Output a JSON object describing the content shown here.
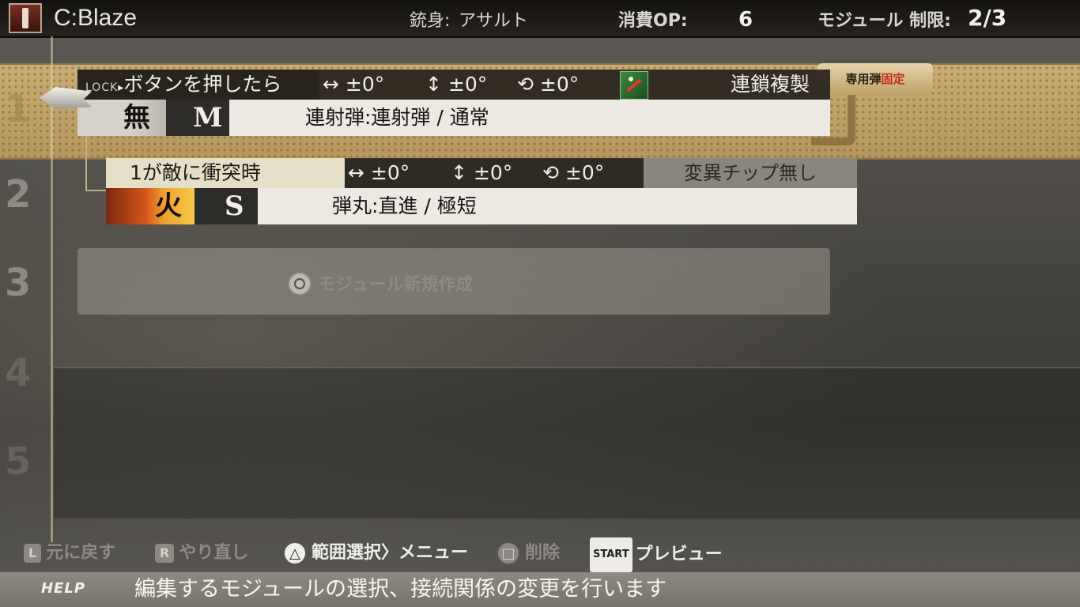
{
  "top_bar": {
    "weapon_name": "C:Blaze",
    "gun_body_label": "銃身:",
    "gun_body_value": "アサルト",
    "op_label": "消費OP:",
    "op_value": "6",
    "module_limit_label": "モジュール 制限:",
    "module_limit_value": "2/3"
  },
  "rows": [
    "1",
    "2",
    "3",
    "4",
    "5"
  ],
  "modules": [
    {
      "lock_tag": "LOCK",
      "trigger": "ボタンを押したら",
      "adjust_h": "↔ ±0°",
      "adjust_v": "↕ ±0°",
      "adjust_rot": "⟲ ±0°",
      "chip_label": "連鎖複製",
      "chip_icon": "chain-copy-chip-icon",
      "attribute": "無",
      "size": "M",
      "bullet": "連射弾:連射弾 / 通常",
      "badge_prefix": "専用弾",
      "badge_suffix": "固定"
    },
    {
      "trigger": "1が敵に衝突時",
      "adjust_h": "↔ ±0°",
      "adjust_v": "↕ ±0°",
      "adjust_rot": "⟲ ±0°",
      "variant": "変異チップ無し",
      "attribute": "火",
      "size": "S",
      "bullet": "弾丸:直進 / 極短"
    }
  ],
  "new_module": {
    "label": "モジュール新規作成",
    "button_icon": "circle-button-icon"
  },
  "hints": [
    {
      "key": "L",
      "label": "元に戻す"
    },
    {
      "key": "R",
      "label": "やり直し"
    },
    {
      "key": "△",
      "label": "範囲選択〉メニュー"
    },
    {
      "key": "□",
      "label": "削除"
    },
    {
      "key": "START",
      "label": "プレビュー"
    }
  ],
  "help": {
    "tag": "HELP",
    "text": "編集するモジュールの選択、接続関係の変更を行います"
  },
  "colors": {
    "selected_row": "#c9ac74",
    "card_bullet_bg": "#ece9e3",
    "card_trigger_bg": "#26221c",
    "fire_attribute": "#d5561a",
    "help_bar": "#8e8a82"
  }
}
